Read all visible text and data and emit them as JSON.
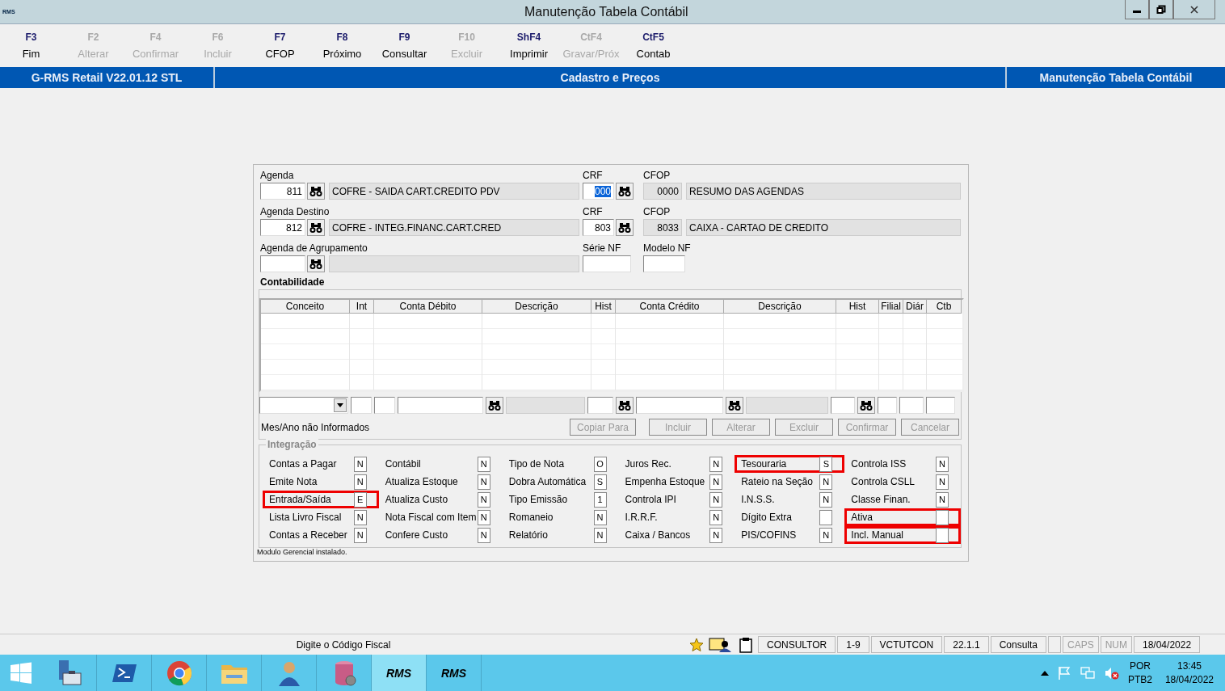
{
  "window": {
    "title": "Manutenção Tabela Contábil",
    "logo": "RMS"
  },
  "toolbar": [
    {
      "key": "F3",
      "label": "Fim",
      "disabled": false
    },
    {
      "key": "F2",
      "label": "Alterar",
      "disabled": true
    },
    {
      "key": "F4",
      "label": "Confirmar",
      "disabled": true
    },
    {
      "key": "F6",
      "label": "Incluir",
      "disabled": true
    },
    {
      "key": "F7",
      "label": "CFOP",
      "disabled": false
    },
    {
      "key": "F8",
      "label": "Próximo",
      "disabled": false
    },
    {
      "key": "F9",
      "label": "Consultar",
      "disabled": false
    },
    {
      "key": "F10",
      "label": "Excluir",
      "disabled": true
    },
    {
      "key": "ShF4",
      "label": "Imprimir",
      "disabled": false
    },
    {
      "key": "CtF4",
      "label": "Gravar/Próx",
      "disabled": true
    },
    {
      "key": "CtF5",
      "label": "Contab",
      "disabled": false
    }
  ],
  "header_band": {
    "version": "G-RMS Retail V22.01.12 STL",
    "module": "Cadastro e Preços",
    "screen": "Manutenção Tabela Contábil"
  },
  "form": {
    "rows": [
      {
        "label": "Agenda",
        "code": "811",
        "description": "COFRE - SAIDA CART.CREDITO PDV",
        "crf_label": "CRF",
        "crf": "000",
        "crf_selected": true,
        "cfop_label": "CFOP",
        "cfop": "0000",
        "cfop_description": "RESUMO DAS AGENDAS"
      },
      {
        "label": "Agenda Destino",
        "code": "812",
        "description": "COFRE - INTEG.FINANC.CART.CRED",
        "crf_label": "CRF",
        "crf": "803",
        "crf_selected": false,
        "cfop_label": "CFOP",
        "cfop": "8033",
        "cfop_description": "CAIXA - CARTAO DE CREDITO"
      }
    ],
    "grouping": {
      "label": "Agenda de Agrupamento",
      "serie_label": "Série NF",
      "modelo_label": "Modelo NF"
    }
  },
  "contabilidade": {
    "title": "Contabilidade",
    "columns": [
      "Conceito",
      "Int",
      "Conta Débito",
      "Descrição",
      "Hist",
      "Conta Crédito",
      "Descrição",
      "Hist",
      "Filial",
      "Diár",
      "Ctb"
    ],
    "entry_row": [
      {
        "kind": "dropdown"
      },
      {
        "kind": "input"
      },
      {
        "kind": "input"
      },
      {
        "kind": "input"
      },
      {
        "kind": "lookup"
      },
      {
        "kind": "readonly"
      },
      {
        "kind": "input"
      },
      {
        "kind": "lookup"
      },
      {
        "kind": "input"
      },
      {
        "kind": "lookup"
      },
      {
        "kind": "readonly"
      },
      {
        "kind": "input"
      },
      {
        "kind": "lookup"
      },
      {
        "kind": "input"
      },
      {
        "kind": "input"
      },
      {
        "kind": "input"
      }
    ],
    "message": "Mes/Ano não Informados",
    "buttons": [
      {
        "label": "Copiar Para",
        "disabled": true
      },
      {
        "label": "Incluir",
        "disabled": true
      },
      {
        "label": "Alterar",
        "disabled": true
      },
      {
        "label": "Excluir",
        "disabled": true
      },
      {
        "label": "Confirmar",
        "disabled": true
      },
      {
        "label": "Cancelar",
        "disabled": true
      }
    ]
  },
  "integracao": {
    "title": "Integração",
    "columns": [
      [
        {
          "label": "Contas a Pagar",
          "value": "N",
          "highlighted": false
        },
        {
          "label": "Emite Nota",
          "value": "N",
          "highlighted": false
        },
        {
          "label": "Entrada/Saída",
          "value": "E",
          "highlighted": true
        },
        {
          "label": "Lista Livro Fiscal",
          "value": "N",
          "highlighted": false
        },
        {
          "label": "Contas a Receber",
          "value": "N",
          "highlighted": false
        }
      ],
      [
        {
          "label": "Contábil",
          "value": "N",
          "highlighted": false
        },
        {
          "label": "Atualiza Estoque",
          "value": "N",
          "highlighted": false
        },
        {
          "label": "Atualiza Custo",
          "value": "N",
          "highlighted": false
        },
        {
          "label": "Nota Fiscal com Item",
          "value": "N",
          "highlighted": false
        },
        {
          "label": "Confere Custo",
          "value": "N",
          "highlighted": false
        }
      ],
      [
        {
          "label": "Tipo de Nota",
          "value": "O",
          "highlighted": false
        },
        {
          "label": "Dobra Automática",
          "value": "S",
          "highlighted": false
        },
        {
          "label": "Tipo Emissão",
          "value": "1",
          "highlighted": false
        },
        {
          "label": "Romaneio",
          "value": "N",
          "highlighted": false
        },
        {
          "label": "Relatório",
          "value": "N",
          "highlighted": false
        }
      ],
      [
        {
          "label": "Juros Rec.",
          "value": "N",
          "highlighted": false
        },
        {
          "label": "Empenha Estoque",
          "value": "N",
          "highlighted": false
        },
        {
          "label": "Controla IPI",
          "value": "N",
          "highlighted": false
        },
        {
          "label": "I.R.R.F.",
          "value": "N",
          "highlighted": false
        },
        {
          "label": "Caixa / Bancos",
          "value": "N",
          "highlighted": false
        }
      ],
      [
        {
          "label": "Tesouraria",
          "value": "S",
          "highlighted": true
        },
        {
          "label": "Rateio na Seção",
          "value": "N",
          "highlighted": false
        },
        {
          "label": "I.N.S.S.",
          "value": "N",
          "highlighted": false
        },
        {
          "label": "Dígito Extra",
          "highlighted": false
        },
        {
          "label": "PIS/COFINS",
          "value": "N",
          "highlighted": false
        }
      ],
      [
        {
          "label": "Controla ISS",
          "value": "N",
          "highlighted": false
        },
        {
          "label": "Controla CSLL",
          "value": "N",
          "highlighted": false
        },
        {
          "label": "Classe Finan.",
          "value": "N",
          "highlighted": false
        },
        {
          "label": "Ativa",
          "highlighted": true
        },
        {
          "label": "Incl. Manual",
          "highlighted": true
        }
      ]
    ],
    "footnote": "Modulo Gerencial instalado."
  },
  "status_bar": {
    "message": "Digite o Código Fiscal",
    "cells": [
      {
        "text": "CONSULTOR",
        "disabled": false
      },
      {
        "text": "1-9",
        "disabled": false
      },
      {
        "text": "VCTUTCON",
        "disabled": false
      },
      {
        "text": "22.1.1",
        "disabled": false
      },
      {
        "text": "Consulta",
        "disabled": false
      },
      {
        "text": "CAPS",
        "disabled": true
      },
      {
        "text": "NUM",
        "disabled": true
      },
      {
        "text": "18/04/2022",
        "disabled": false
      }
    ]
  },
  "taskbar": {
    "apps": [
      {
        "kind": "start",
        "selected": false
      },
      {
        "kind": "server-manager",
        "selected": false
      },
      {
        "kind": "powershell",
        "selected": false
      },
      {
        "kind": "browser",
        "selected": false
      },
      {
        "kind": "explorer",
        "selected": false
      },
      {
        "kind": "user",
        "selected": false
      },
      {
        "kind": "database",
        "selected": false
      },
      {
        "kind": "rms",
        "label": "RMS",
        "selected": true
      },
      {
        "kind": "rms",
        "label": "RMS",
        "selected": false
      }
    ],
    "language": "POR",
    "layout": "PTB2",
    "time": "13:45",
    "date": "18/04/2022"
  }
}
